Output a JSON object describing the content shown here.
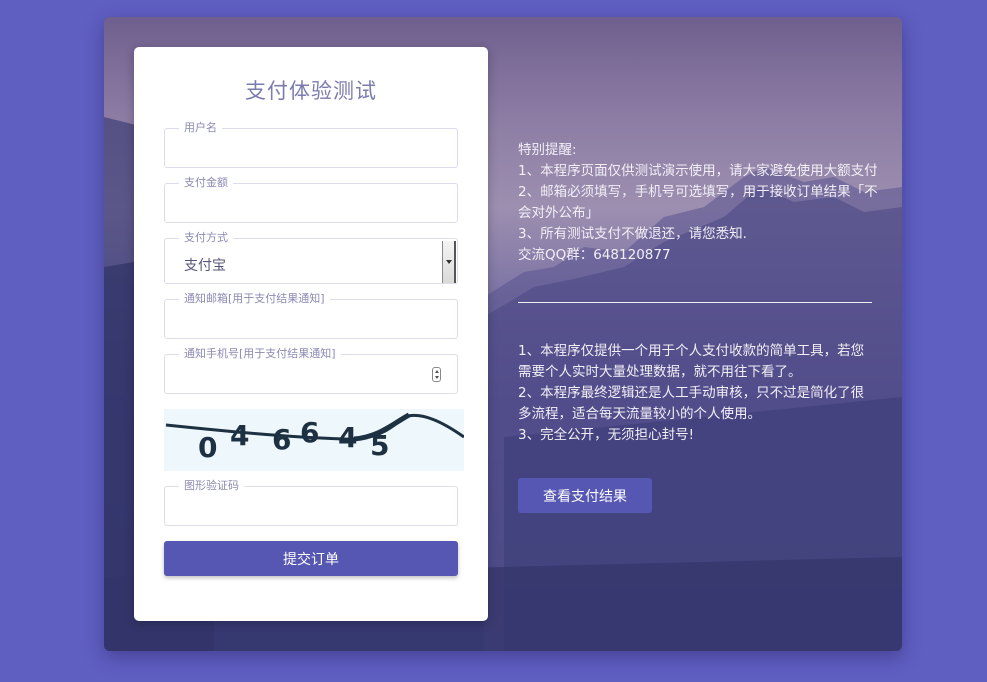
{
  "form": {
    "title": "支付体验测试",
    "username_label": "用户名",
    "amount_label": "支付金额",
    "method_label": "支付方式",
    "method_value": "支付宝",
    "email_label": "通知邮箱[用于支付结果通知]",
    "phone_label": "通知手机号[用于支付结果通知]",
    "captcha_text": "046645",
    "captcha_label": "图形验证码",
    "submit_label": "提交订单"
  },
  "notice": {
    "heading": "特别提醒:",
    "lines": [
      "1、本程序页面仅供测试演示使用，请大家避免使用大额支付",
      "2、邮箱必须填写，手机号可选填写，用于接收订单结果「不会对外公布」",
      "3、所有测试支付不做退还，请您悉知.",
      "交流QQ群：648120877"
    ]
  },
  "about": {
    "lines": [
      "1、本程序仅提供一个用于个人支付收款的简单工具，若您需要个人实时大量处理数据，就不用往下看了。",
      "2、本程序最终逻辑还是人工手动审核，只不过是简化了很多流程，适合每天流量较小的个人使用。",
      "3、完全公开，无须担心封号!"
    ]
  },
  "result_button_label": "查看支付结果",
  "colors": {
    "page_bg": "#5f5fc2",
    "accent": "#5656b3",
    "title": "#7b7cae"
  }
}
